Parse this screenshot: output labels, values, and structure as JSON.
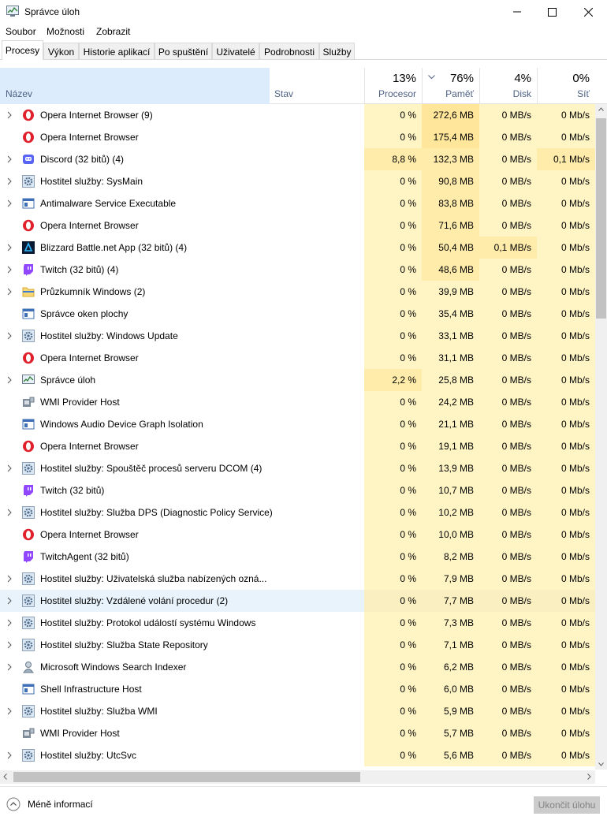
{
  "window": {
    "title": "Správce úloh"
  },
  "menu": [
    "Soubor",
    "Možnosti",
    "Zobrazit"
  ],
  "tabs": [
    "Procesy",
    "Výkon",
    "Historie aplikací",
    "Po spuštění",
    "Uživatelé",
    "Podrobnosti",
    "Služby"
  ],
  "active_tab": "Procesy",
  "columns": {
    "name": "Název",
    "status": "Stav",
    "cpu": {
      "pct": "13%",
      "label": "Procesor"
    },
    "memory": {
      "pct": "76%",
      "label": "Paměť",
      "sorted": "descending"
    },
    "disk": {
      "pct": "4%",
      "label": "Disk"
    },
    "network": {
      "pct": "0%",
      "label": "Síť"
    }
  },
  "processes": [
    {
      "name": "Opera Internet Browser (9)",
      "icon": "opera-icon",
      "expand": true,
      "cpu": "0 %",
      "mem": "272,6 MB",
      "disk": "0 MB/s",
      "net": "0 Mb/s"
    },
    {
      "name": "Opera Internet Browser",
      "icon": "opera-icon",
      "expand": false,
      "cpu": "0 %",
      "mem": "175,4 MB",
      "disk": "0 MB/s",
      "net": "0 Mb/s"
    },
    {
      "name": "Discord (32 bitů) (4)",
      "icon": "discord-icon",
      "expand": true,
      "cpu": "8,8 %",
      "mem": "132,3 MB",
      "disk": "0 MB/s",
      "net": "0,1 Mb/s"
    },
    {
      "name": "Hostitel služby: SysMain",
      "icon": "gear-icon",
      "expand": true,
      "cpu": "0 %",
      "mem": "90,8 MB",
      "disk": "0 MB/s",
      "net": "0 Mb/s"
    },
    {
      "name": "Antimalware Service Executable",
      "icon": "window-icon",
      "expand": true,
      "cpu": "0 %",
      "mem": "83,8 MB",
      "disk": "0 MB/s",
      "net": "0 Mb/s"
    },
    {
      "name": "Opera Internet Browser",
      "icon": "opera-icon",
      "expand": false,
      "cpu": "0 %",
      "mem": "71,6 MB",
      "disk": "0 MB/s",
      "net": "0 Mb/s"
    },
    {
      "name": "Blizzard Battle.net App (32 bitů) (4)",
      "icon": "battlenet-icon",
      "expand": true,
      "cpu": "0 %",
      "mem": "50,4 MB",
      "disk": "0,1 MB/s",
      "net": "0 Mb/s"
    },
    {
      "name": "Twitch (32 bitů) (4)",
      "icon": "twitch-icon",
      "expand": true,
      "cpu": "0 %",
      "mem": "48,6 MB",
      "disk": "0 MB/s",
      "net": "0 Mb/s"
    },
    {
      "name": "Průzkumník Windows (2)",
      "icon": "folder-icon",
      "expand": true,
      "cpu": "0 %",
      "mem": "39,9 MB",
      "disk": "0 MB/s",
      "net": "0 Mb/s"
    },
    {
      "name": "Správce oken plochy",
      "icon": "window-icon",
      "expand": false,
      "cpu": "0 %",
      "mem": "35,4 MB",
      "disk": "0 MB/s",
      "net": "0 Mb/s"
    },
    {
      "name": "Hostitel služby: Windows Update",
      "icon": "gear-icon",
      "expand": true,
      "cpu": "0 %",
      "mem": "33,1 MB",
      "disk": "0 MB/s",
      "net": "0 Mb/s"
    },
    {
      "name": "Opera Internet Browser",
      "icon": "opera-icon",
      "expand": false,
      "cpu": "0 %",
      "mem": "31,1 MB",
      "disk": "0 MB/s",
      "net": "0 Mb/s"
    },
    {
      "name": "Správce úloh",
      "icon": "taskmgr-icon",
      "expand": true,
      "cpu": "2,2 %",
      "mem": "25,8 MB",
      "disk": "0 MB/s",
      "net": "0 Mb/s"
    },
    {
      "name": "WMI Provider Host",
      "icon": "wmi-icon",
      "expand": false,
      "cpu": "0 %",
      "mem": "24,2 MB",
      "disk": "0 MB/s",
      "net": "0 Mb/s"
    },
    {
      "name": "Windows Audio Device Graph Isolation",
      "icon": "window-icon",
      "expand": false,
      "cpu": "0 %",
      "mem": "21,1 MB",
      "disk": "0 MB/s",
      "net": "0 Mb/s"
    },
    {
      "name": "Opera Internet Browser",
      "icon": "opera-icon",
      "expand": false,
      "cpu": "0 %",
      "mem": "19,1 MB",
      "disk": "0 MB/s",
      "net": "0 Mb/s"
    },
    {
      "name": "Hostitel služby: Spouštěč procesů serveru DCOM (4)",
      "icon": "gear-icon",
      "expand": true,
      "cpu": "0 %",
      "mem": "13,9 MB",
      "disk": "0 MB/s",
      "net": "0 Mb/s"
    },
    {
      "name": "Twitch (32 bitů)",
      "icon": "twitch-icon",
      "expand": false,
      "cpu": "0 %",
      "mem": "10,7 MB",
      "disk": "0 MB/s",
      "net": "0 Mb/s"
    },
    {
      "name": "Hostitel služby: Služba DPS (Diagnostic Policy Service)",
      "icon": "gear-icon",
      "expand": true,
      "cpu": "0 %",
      "mem": "10,2 MB",
      "disk": "0 MB/s",
      "net": "0 Mb/s"
    },
    {
      "name": "Opera Internet Browser",
      "icon": "opera-icon",
      "expand": false,
      "cpu": "0 %",
      "mem": "10,0 MB",
      "disk": "0 MB/s",
      "net": "0 Mb/s"
    },
    {
      "name": "TwitchAgent (32 bitů)",
      "icon": "twitch-icon",
      "expand": false,
      "cpu": "0 %",
      "mem": "8,2 MB",
      "disk": "0 MB/s",
      "net": "0 Mb/s"
    },
    {
      "name": "Hostitel služby: Uživatelská služba nabízených ozná...",
      "icon": "gear-icon",
      "expand": true,
      "cpu": "0 %",
      "mem": "7,9 MB",
      "disk": "0 MB/s",
      "net": "0 Mb/s"
    },
    {
      "name": "Hostitel služby: Vzdálené volání procedur (2)",
      "icon": "gear-icon",
      "expand": true,
      "cpu": "0 %",
      "mem": "7,7 MB",
      "disk": "0 MB/s",
      "net": "0 Mb/s",
      "highlight": true
    },
    {
      "name": "Hostitel služby: Protokol událostí systému Windows",
      "icon": "gear-icon",
      "expand": true,
      "cpu": "0 %",
      "mem": "7,3 MB",
      "disk": "0 MB/s",
      "net": "0 Mb/s"
    },
    {
      "name": "Hostitel služby: Služba State Repository",
      "icon": "gear-icon",
      "expand": true,
      "cpu": "0 %",
      "mem": "7,1 MB",
      "disk": "0 MB/s",
      "net": "0 Mb/s"
    },
    {
      "name": "Microsoft Windows Search Indexer",
      "icon": "search-indexer-icon",
      "expand": true,
      "cpu": "0 %",
      "mem": "6,2 MB",
      "disk": "0 MB/s",
      "net": "0 Mb/s"
    },
    {
      "name": "Shell Infrastructure Host",
      "icon": "window-icon",
      "expand": false,
      "cpu": "0 %",
      "mem": "6,0 MB",
      "disk": "0 MB/s",
      "net": "0 Mb/s"
    },
    {
      "name": "Hostitel služby: Služba WMI",
      "icon": "gear-icon",
      "expand": true,
      "cpu": "0 %",
      "mem": "5,9 MB",
      "disk": "0 MB/s",
      "net": "0 Mb/s"
    },
    {
      "name": "WMI Provider Host",
      "icon": "wmi-icon",
      "expand": false,
      "cpu": "0 %",
      "mem": "5,7 MB",
      "disk": "0 MB/s",
      "net": "0 Mb/s"
    },
    {
      "name": "Hostitel služby: UtcSvc",
      "icon": "gear-icon",
      "expand": true,
      "cpu": "0 %",
      "mem": "5,6 MB",
      "disk": "0 MB/s",
      "net": "0 Mb/s"
    }
  ],
  "footer": {
    "less_info": "Méně informací",
    "end_task": "Ukončit úlohu"
  },
  "colors": {
    "light": "#fff4c4",
    "medium": "#ffecab",
    "strong": "#ffe69a",
    "name_header": "#dcecfc",
    "highlight_row": "#e8f3fc"
  }
}
